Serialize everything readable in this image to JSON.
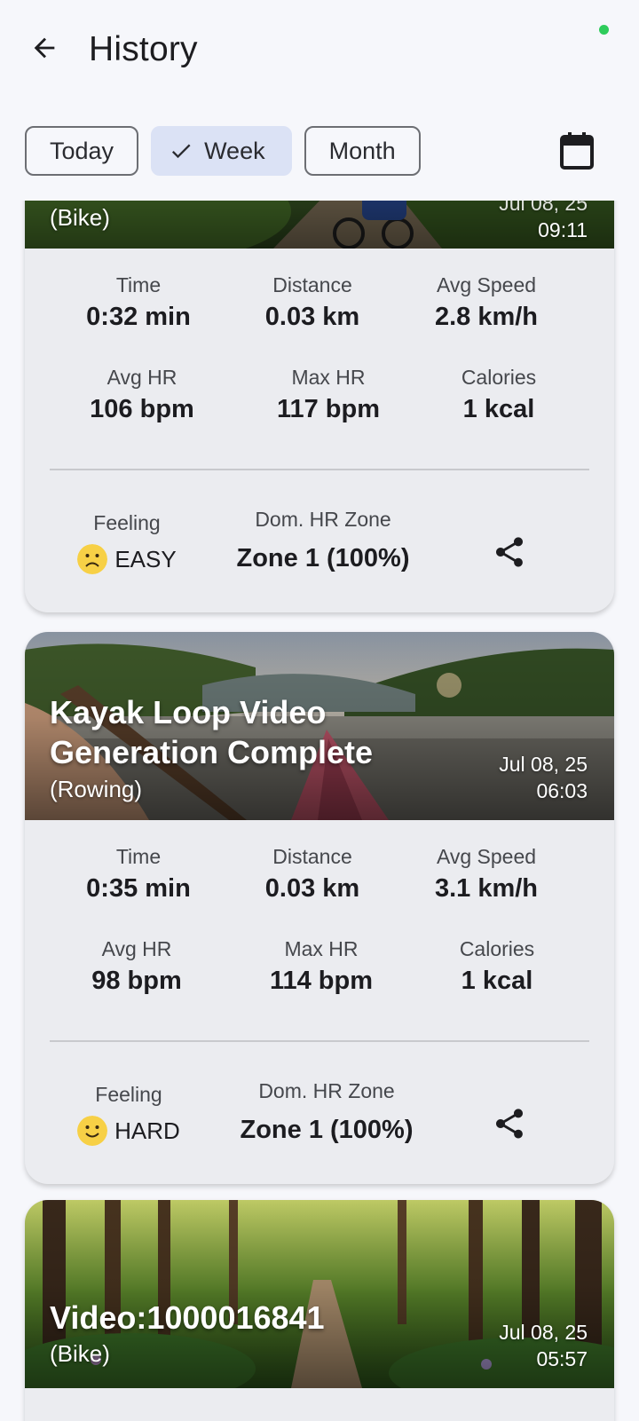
{
  "header": {
    "title": "History"
  },
  "filters": {
    "today": "Today",
    "week": "Week",
    "month": "Month",
    "selected": "Week"
  },
  "labels": {
    "time": "Time",
    "distance": "Distance",
    "avg_speed": "Avg Speed",
    "avg_hr": "Avg HR",
    "max_hr": "Max HR",
    "calories": "Calories",
    "feeling": "Feeling",
    "dom_hr_zone": "Dom. HR Zone"
  },
  "workouts": [
    {
      "title": "",
      "sport": "(Bike)",
      "date": "Jul 08, 25",
      "time_of_day": "09:11",
      "time": "0:32 min",
      "distance": "0.03 km",
      "avg_speed": "2.8 km/h",
      "avg_hr": "106 bpm",
      "max_hr": "117 bpm",
      "calories": "1 kcal",
      "feeling": "EASY",
      "feeling_icon": "frown-emoji-icon",
      "zone": "Zone 1 (100%)"
    },
    {
      "title": "Kayak Loop Video Generation Complete",
      "sport": "(Rowing)",
      "date": "Jul 08, 25",
      "time_of_day": "06:03",
      "time": "0:35 min",
      "distance": "0.03 km",
      "avg_speed": "3.1 km/h",
      "avg_hr": "98 bpm",
      "max_hr": "114 bpm",
      "calories": "1 kcal",
      "feeling": "HARD",
      "feeling_icon": "smile-emoji-icon",
      "zone": "Zone 1 (100%)"
    },
    {
      "title": "Video:1000016841",
      "sport": "(Bike)",
      "date": "Jul 08, 25",
      "time_of_day": "05:57"
    }
  ],
  "colors": {
    "accent_chip": "#dbe2f5",
    "status_dot": "#2ecc5b",
    "emoji": "#f7d046"
  }
}
